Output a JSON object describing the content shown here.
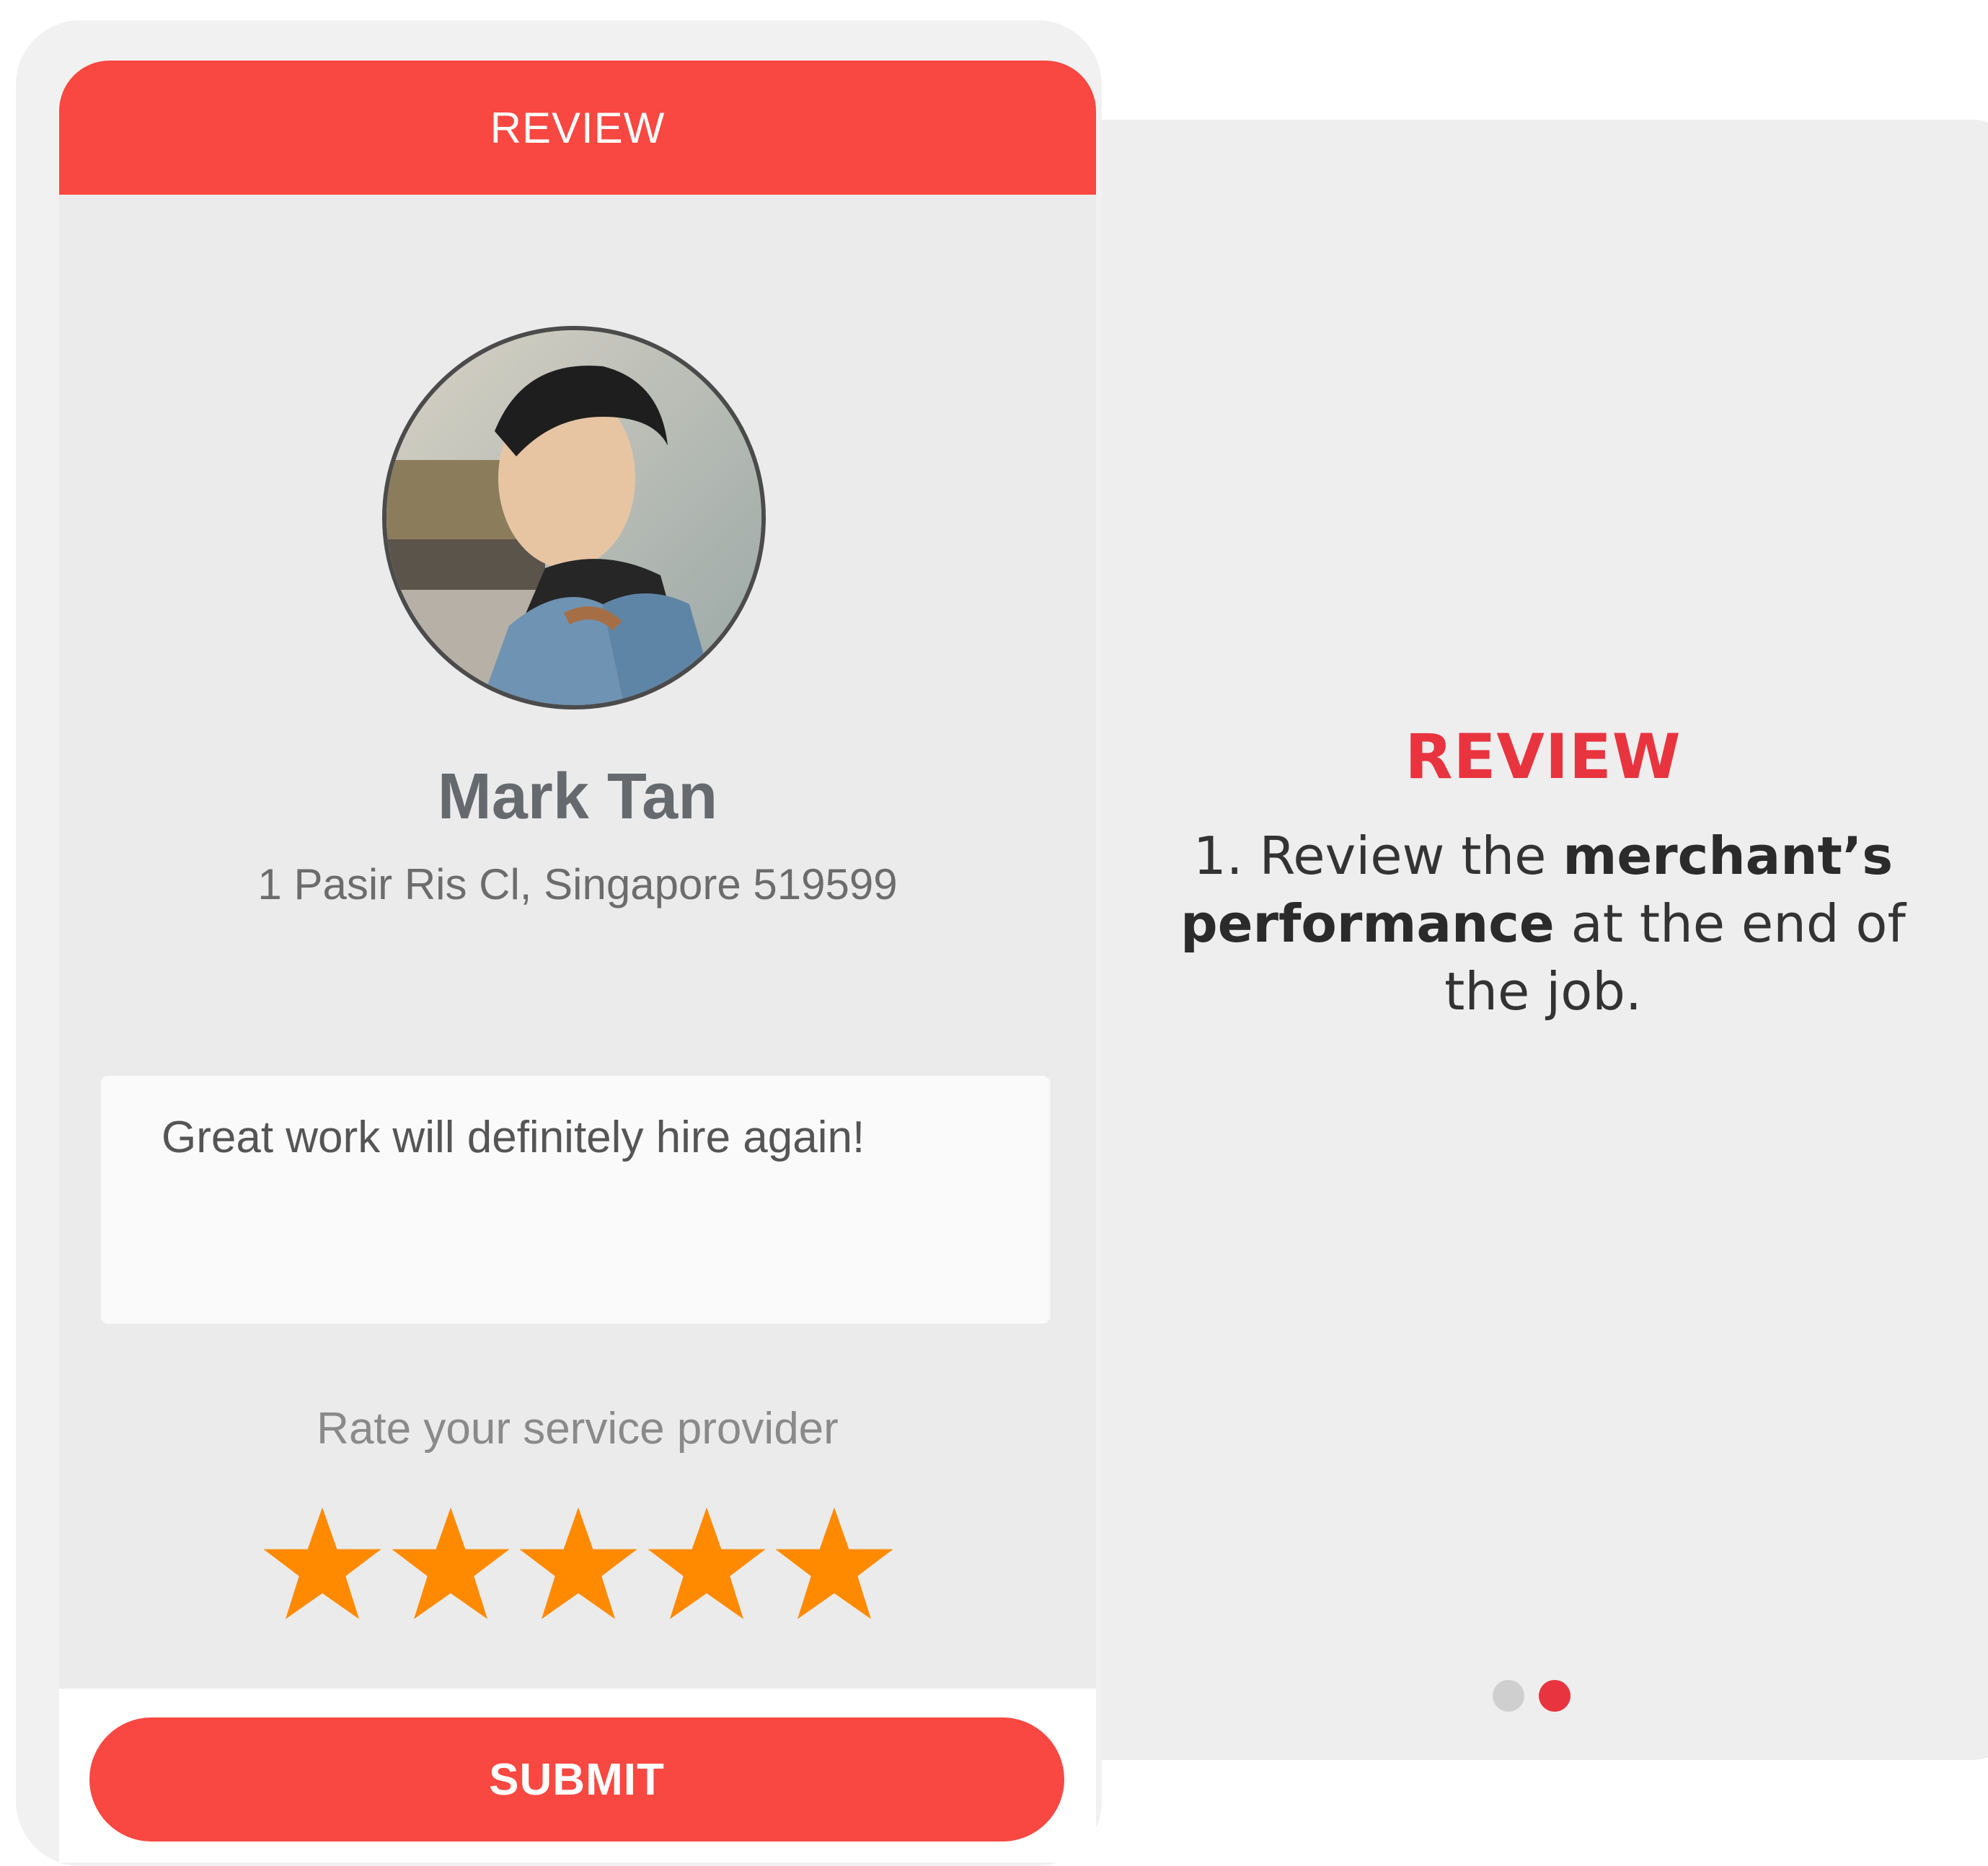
{
  "screen": {
    "header_title": "REVIEW",
    "merchant": {
      "name": "Mark Tan",
      "address": "1 Pasir Ris Cl, Singapore 519599"
    },
    "review_text": "Great work will definitely hire again!",
    "rating_label": "Rate your service provider",
    "rating": {
      "value": 5,
      "max": 5
    },
    "submit_label": "SUBMIT"
  },
  "info": {
    "title": "REVIEW",
    "text_prefix": "1. Review the ",
    "text_bold": "merchant’s performance",
    "text_suffix": " at the end of the job."
  },
  "pager": {
    "total": 2,
    "active_index": 1
  },
  "colors": {
    "accent": "#f94741",
    "info_accent": "#e8343f",
    "star": "#ff8a00",
    "panel_bg": "#eeeeee"
  }
}
